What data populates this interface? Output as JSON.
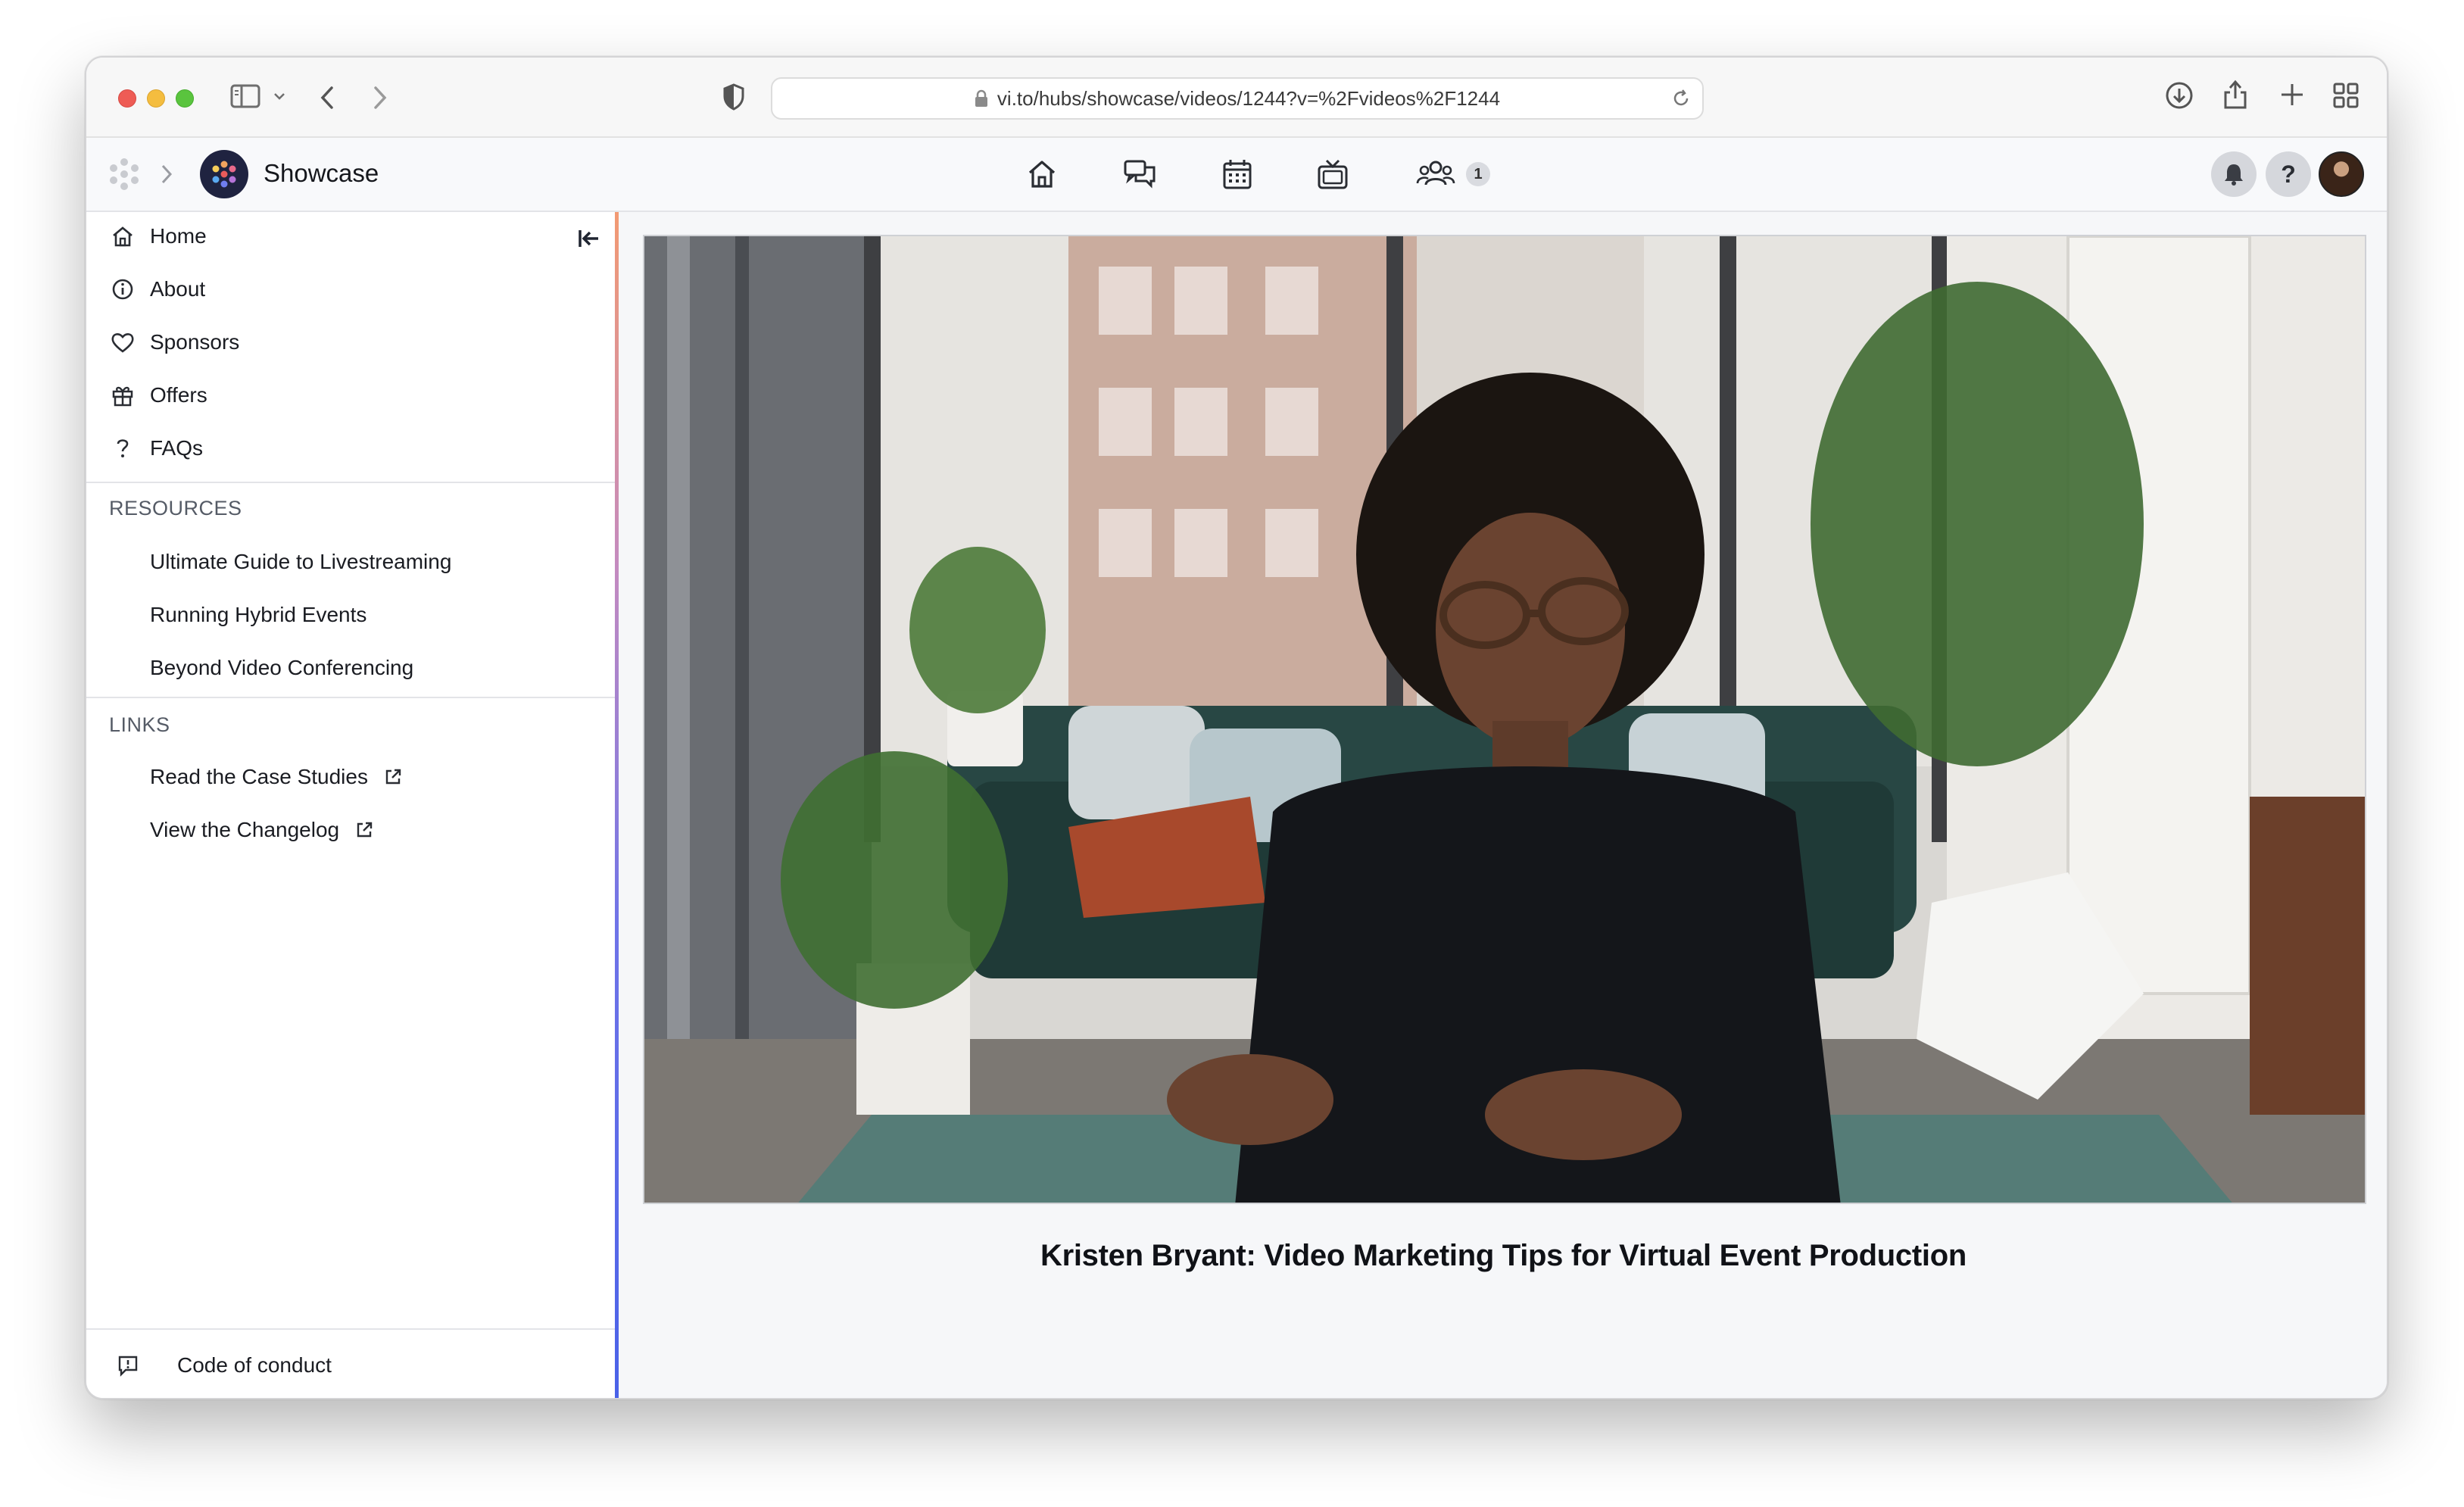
{
  "browser": {
    "url": "vi.to/hubs/showcase/videos/1244?v=%2Fvideos%2F1244"
  },
  "header": {
    "app_title": "Showcase",
    "community_badge_count": "1",
    "help_label": "?"
  },
  "sidebar": {
    "primary": [
      {
        "label": "Home",
        "icon": "home-icon"
      },
      {
        "label": "About",
        "icon": "info-icon"
      },
      {
        "label": "Sponsors",
        "icon": "heart-icon"
      },
      {
        "label": "Offers",
        "icon": "gift-icon"
      },
      {
        "label": "FAQs",
        "icon": "question-icon"
      }
    ],
    "resources_heading": "RESOURCES",
    "resources": [
      {
        "label": "Ultimate Guide to Livestreaming"
      },
      {
        "label": "Running Hybrid Events"
      },
      {
        "label": "Beyond Video Conferencing"
      }
    ],
    "links_heading": "LINKS",
    "links": [
      {
        "label": "Read the Case Studies",
        "icon": "external-link-icon"
      },
      {
        "label": "View the Changelog",
        "icon": "external-link-icon"
      }
    ],
    "footer_label": "Code of conduct"
  },
  "main": {
    "video_title": "Kristen Bryant: Video Marketing Tips for Virtual Event Production"
  },
  "colors": {
    "sidebar_accent_top": "#f29a73",
    "sidebar_accent_bottom": "#4a62e8",
    "hub_logo_bg": "#1f2340"
  }
}
